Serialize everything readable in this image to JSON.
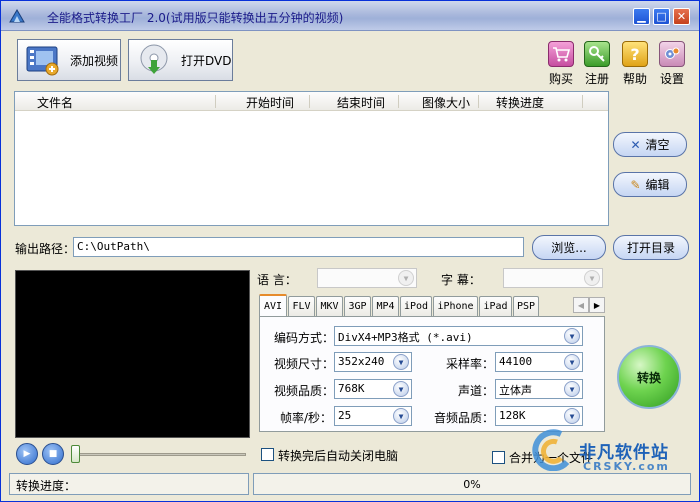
{
  "window": {
    "title": "全能格式转换工厂 2.0(试用版只能转换出五分钟的视频)"
  },
  "toolbar": {
    "add_video": "添加视频",
    "open_dvd": "打开DVD",
    "buy": "购买",
    "register": "注册",
    "help": "帮助",
    "settings": "设置"
  },
  "file_list": {
    "columns": [
      "文件名",
      "开始时间",
      "结束时间",
      "图像大小",
      "转换进度"
    ],
    "rows": []
  },
  "side_buttons": {
    "clear": "清空",
    "edit": "编辑"
  },
  "output": {
    "label": "输出路径：",
    "path": "C:\\OutPath\\",
    "browse": "浏览...",
    "open_dir": "打开目录"
  },
  "audio_sub": {
    "language_label": "语    言：",
    "subtitle_label": "字    幕：",
    "language_value": "",
    "subtitle_value": ""
  },
  "format_tabs": [
    "AVI",
    "FLV",
    "MKV",
    "3GP",
    "MP4",
    "iPod",
    "iPhone",
    "iPad",
    "PSP"
  ],
  "format_settings": {
    "codec_label": "编码方式：",
    "codec_value": "DivX4+MP3格式 (*.avi)",
    "size_label": "视频尺寸：",
    "size_value": "352x240",
    "quality_label": "视频品质：",
    "quality_value": "768K",
    "fps_label": "帧率/秒：",
    "fps_value": "25",
    "samplerate_label": "采样率：",
    "samplerate_value": "44100",
    "channel_label": "声道：",
    "channel_value": "立体声",
    "audio_quality_label": "音频品质：",
    "audio_quality_value": "128K"
  },
  "convert_button": "转换",
  "options": {
    "shutdown": "转换完后自动关闭电脑",
    "merge": "合并为一个文件"
  },
  "status": {
    "progress_label": "转换进度：",
    "progress_text": "0%",
    "progress_fraction": 0
  },
  "watermark": {
    "main": "非凡软件站",
    "sub": "CRSKY.com"
  },
  "colors": {
    "title_text": "#1b1b8a",
    "window_bg": "#ece9d8",
    "convert_green": "#4fc23a",
    "watermark_blue": "#1e62b8"
  }
}
